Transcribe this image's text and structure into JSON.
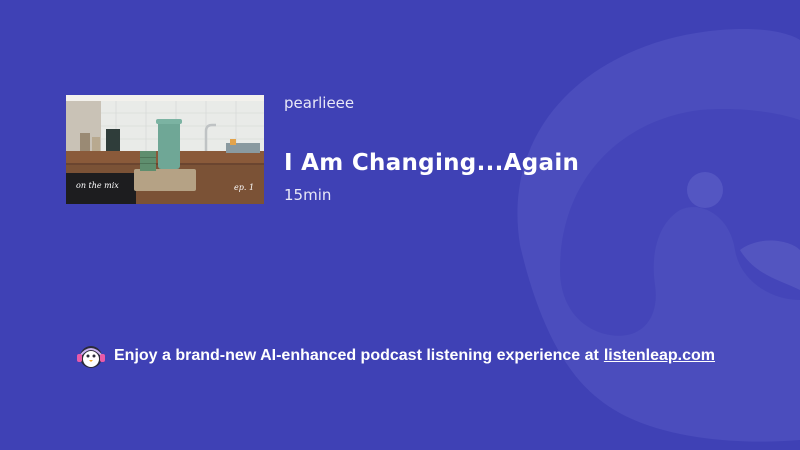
{
  "episode": {
    "author": "pearlieee",
    "title": "I Am Changing...Again",
    "duration": "15min",
    "cover_caption_left": "on the mix",
    "cover_caption_right": "ep. 1"
  },
  "promo": {
    "text": "Enjoy a brand-new AI-enhanced podcast listening experience at",
    "link_label": "listenleap.com"
  },
  "icons": {
    "mascot": "penguin-headphones-icon",
    "watermark": "listenleap-logo-watermark"
  },
  "colors": {
    "background": "#3f41b5",
    "watermark": "#5355c0",
    "text": "#ffffff"
  }
}
